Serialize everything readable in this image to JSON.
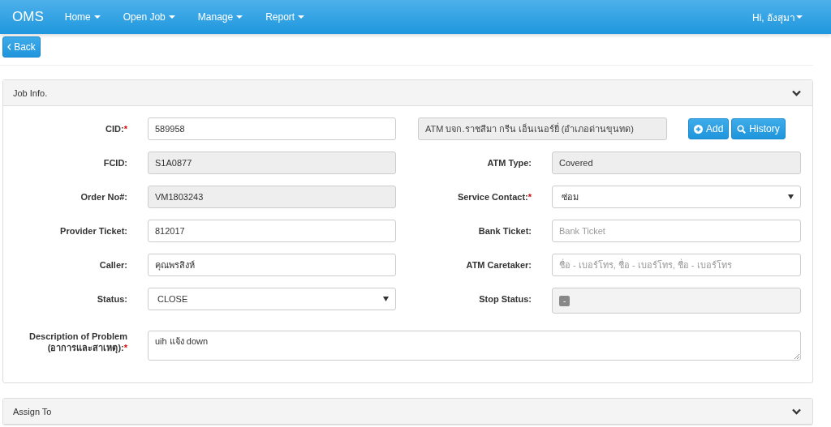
{
  "navbar": {
    "brand": "OMS",
    "menus": [
      {
        "label": "Home"
      },
      {
        "label": "Open Job"
      },
      {
        "label": "Manage"
      },
      {
        "label": "Report"
      }
    ],
    "user": "Hi, อังสุมา"
  },
  "back_button": {
    "label": "Back"
  },
  "panels": [
    {
      "title": "Job Info.",
      "expanded": true,
      "fields": [
        {
          "kind": "text",
          "label": "CID:",
          "mark": "*",
          "value": "589958"
        },
        {
          "kind": "lookup",
          "value": "ATM บจก.ราชสีมา กรีน เอ็นเนอร์ยี่ (อำเภอด่านขุนทด)",
          "buttons": [
            {
              "kind": "add",
              "label": "Add"
            },
            {
              "kind": "history",
              "label": "History"
            }
          ]
        },
        {
          "kind": "readonly",
          "label": "FCID:",
          "value": "S1A0877"
        },
        {
          "kind": "readonly",
          "label": "ATM Type:",
          "value": "Covered"
        },
        {
          "kind": "readonly",
          "label": "Order No#:",
          "value": "VM1803243"
        },
        {
          "kind": "select",
          "label": "Service Contact:",
          "mark": "*",
          "value": "ซ่อม"
        },
        {
          "kind": "text",
          "label": "Provider Ticket:",
          "value": "812017"
        },
        {
          "kind": "text",
          "label": "Bank Ticket:",
          "placeholder": "Bank Ticket"
        },
        {
          "kind": "text",
          "label": "Caller:",
          "value": "คุณพรสิงห์"
        },
        {
          "kind": "text",
          "label": "ATM Caretaker:",
          "placeholder": "ชื่อ - เบอร์โทร, ชื่อ - เบอร์โทร, ชื่อ - เบอร์โทร"
        },
        {
          "kind": "select",
          "label": "Status:",
          "value": "CLOSE"
        },
        {
          "kind": "badge",
          "label": "Stop Status:",
          "value": "-"
        },
        {
          "kind": "textarea",
          "label": "Description of Problem (อาการและสาเหตุ):",
          "mark": "*",
          "value": "uih แจ้ง down"
        }
      ]
    },
    {
      "title": "Assign To",
      "expanded": false
    }
  ]
}
